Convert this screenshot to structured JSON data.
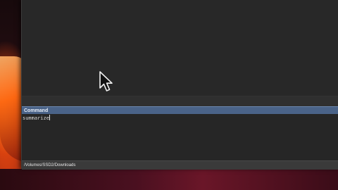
{
  "command_panel": {
    "title": "Command",
    "input_value": "summarize"
  },
  "status_bar": {
    "path": "/Volumes/SSD2/Downloads"
  },
  "colors": {
    "command_header": "#4a6388",
    "window_bg": "#282828",
    "status_bar_bg": "#3a3a3a"
  },
  "icons": {
    "pointer": "arrow-cursor-icon"
  }
}
